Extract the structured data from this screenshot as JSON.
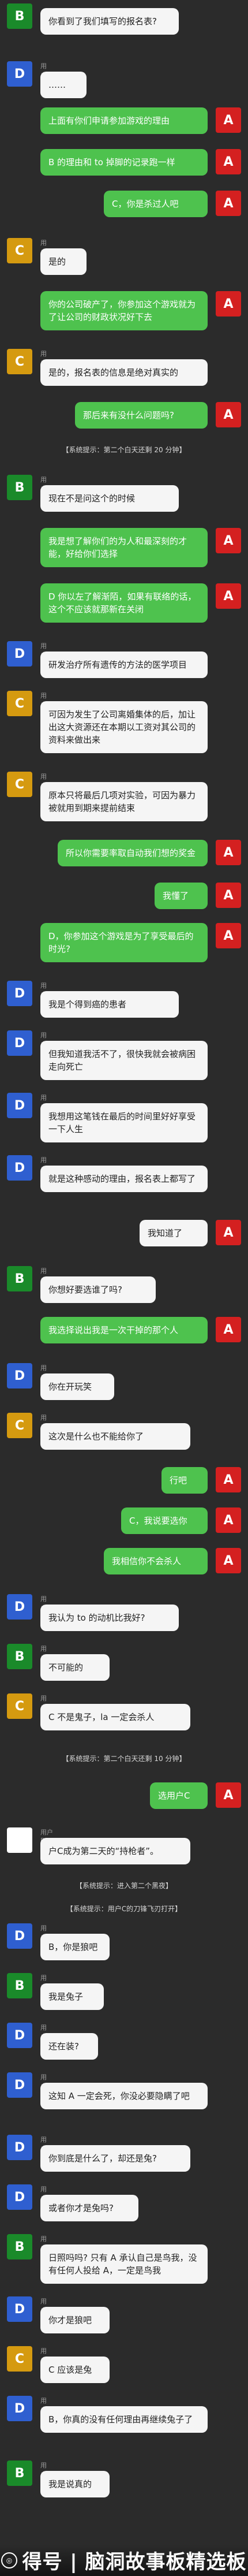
{
  "chat": {
    "messages": [
      {
        "id": 1,
        "type": "msg",
        "side": "left",
        "avatar": "B",
        "name": "",
        "text": "你看到了我们填写的报名表?",
        "bubble": "white"
      },
      {
        "id": 2,
        "type": "msg",
        "side": "left",
        "avatar": "D",
        "name": "用户D",
        "text": "……",
        "bubble": "white"
      },
      {
        "id": 3,
        "type": "msg",
        "side": "right",
        "avatar": "A",
        "text": "上面有你们申请参加游戏的理由",
        "bubble": "green"
      },
      {
        "id": 4,
        "type": "msg",
        "side": "right",
        "avatar": "A",
        "text": "B 的理由和 to 掉脚的记录跑一样",
        "bubble": "green"
      },
      {
        "id": 5,
        "type": "msg",
        "side": "right",
        "avatar": "A",
        "text": "C，你是杀过人吧",
        "bubble": "green"
      },
      {
        "id": 6,
        "type": "msg",
        "side": "left",
        "avatar": "C",
        "name": "用户C",
        "text": "是的",
        "bubble": "white"
      },
      {
        "id": 7,
        "type": "msg",
        "side": "right",
        "avatar": "A",
        "text": "你的公司破产了，你参加这个游戏就为了让公司的财政状况好下去",
        "bubble": "green"
      },
      {
        "id": 8,
        "type": "msg",
        "side": "left",
        "avatar": "C",
        "name": "用户C",
        "text": "是的，报名表的信息是绝对真实的",
        "bubble": "white"
      },
      {
        "id": 9,
        "type": "msg",
        "side": "right",
        "avatar": "A",
        "text": "那后来有没什么问题吗?",
        "bubble": "green"
      },
      {
        "id": 10,
        "type": "sys",
        "text": "【系统提示：第二个白天还剩 20 分钟】"
      },
      {
        "id": 11,
        "type": "msg",
        "side": "left",
        "avatar": "B",
        "name": "用户B",
        "text": "现在不是问这个的时候",
        "bubble": "white"
      },
      {
        "id": 12,
        "type": "msg",
        "side": "right",
        "avatar": "A",
        "text": "我是想了解你们的为人和最深刻的才能，好给你们选择",
        "bubble": "green"
      },
      {
        "id": 13,
        "type": "msg",
        "side": "right",
        "avatar": "A",
        "text": "D 你以左了解渐陌，如果有联络的话，这个不应该就那新在关闭",
        "bubble": "green"
      },
      {
        "id": 14,
        "type": "msg",
        "side": "left",
        "avatar": "D",
        "name": "用户D",
        "text": "研发治疗所有遗传的方法的医学项目",
        "bubble": "white"
      },
      {
        "id": 15,
        "type": "msg",
        "side": "left",
        "avatar": "C",
        "name": "用户C",
        "text": "可因为发生了公司离婚集体的后，加让出这大资源还在本期以工资对其公司的资料来做出来",
        "bubble": "white"
      },
      {
        "id": 16,
        "type": "msg",
        "side": "left",
        "avatar": "C",
        "name": "用户C",
        "text": "原本只将最后几项对实验，可因为暴力被就用到期来提前结束",
        "bubble": "white"
      },
      {
        "id": 17,
        "type": "msg",
        "side": "right",
        "avatar": "A",
        "text": "所以你需要率取自动我们想的奖金",
        "bubble": "green"
      },
      {
        "id": 18,
        "type": "msg",
        "side": "right",
        "avatar": "A",
        "text": "我懂了",
        "bubble": "green"
      },
      {
        "id": 19,
        "type": "msg",
        "side": "right",
        "avatar": "A",
        "text": "D，你参加这个游戏是为了享受最后的时光?",
        "bubble": "green"
      },
      {
        "id": 20,
        "type": "msg",
        "side": "left",
        "avatar": "D",
        "name": "用户D",
        "text": "我是个得到癌的患者",
        "bubble": "white"
      },
      {
        "id": 21,
        "type": "msg",
        "side": "left",
        "avatar": "D",
        "name": "用户D",
        "text": "但我知道我活不了，很快我就会被病困走向死亡",
        "bubble": "white"
      },
      {
        "id": 22,
        "type": "msg",
        "side": "left",
        "avatar": "D",
        "name": "用户D",
        "text": "我想用这笔钱在最后的时间里好好享受一下人生",
        "bubble": "white"
      },
      {
        "id": 23,
        "type": "msg",
        "side": "left",
        "avatar": "D",
        "name": "用户D",
        "text": "就是这种感动的理由，报名表上都写了",
        "bubble": "white"
      },
      {
        "id": 24,
        "type": "msg",
        "side": "right",
        "avatar": "A",
        "text": "我知道了",
        "bubble": "white"
      },
      {
        "id": 25,
        "type": "msg",
        "side": "left",
        "avatar": "B",
        "name": "用户B",
        "text": "你想好要选谁了吗?",
        "bubble": "white"
      },
      {
        "id": 26,
        "type": "msg",
        "side": "right",
        "avatar": "A",
        "text": "我选择说出我是一次干掉的那个人",
        "bubble": "green"
      },
      {
        "id": 27,
        "type": "msg",
        "side": "left",
        "avatar": "D",
        "name": "用户D",
        "text": "你在开玩笑",
        "bubble": "white"
      },
      {
        "id": 28,
        "type": "msg",
        "side": "left",
        "avatar": "C",
        "name": "用户C",
        "text": "这次是什么也不能给你了",
        "bubble": "white"
      },
      {
        "id": 29,
        "type": "msg",
        "side": "right",
        "avatar": "A",
        "text": "行吧",
        "bubble": "green"
      },
      {
        "id": 30,
        "type": "msg",
        "side": "right",
        "avatar": "A",
        "text": "C，我说要选你",
        "bubble": "green"
      },
      {
        "id": 31,
        "type": "msg",
        "side": "right",
        "avatar": "A",
        "text": "我相信你不会杀人",
        "bubble": "green"
      },
      {
        "id": 32,
        "type": "msg",
        "side": "left",
        "avatar": "D",
        "name": "用户D",
        "text": "我认为 to 的动机比我好?",
        "bubble": "white"
      },
      {
        "id": 33,
        "type": "msg",
        "side": "left",
        "avatar": "B",
        "name": "用户B",
        "text": "不可能的",
        "bubble": "white"
      },
      {
        "id": 34,
        "type": "msg",
        "side": "left",
        "avatar": "C",
        "name": "用户C",
        "text": "C 不是鬼子，la 一定会杀人",
        "bubble": "white"
      },
      {
        "id": 35,
        "type": "sys",
        "text": "【系统提示：第二个白天还剩 10 分钟】"
      },
      {
        "id": 36,
        "type": "msg",
        "side": "right",
        "avatar": "A",
        "text": "选用户C",
        "bubble": "green"
      },
      {
        "id": 37,
        "type": "msg",
        "side": "left",
        "avatar": "P",
        "name": "用户D(A)",
        "text": "户C成为第二天的“持枪者”。",
        "bubble": "white"
      },
      {
        "id": 38,
        "type": "sys",
        "text": "【系统提示：进入第二个黑夜】"
      },
      {
        "id": 39,
        "type": "sys",
        "text": "【系统提示：用户C的刀锋飞刃打开】"
      },
      {
        "id": 40,
        "type": "msg",
        "side": "left",
        "avatar": "D",
        "name": "用户D",
        "text": "B，你是狼吧",
        "bubble": "white"
      },
      {
        "id": 41,
        "type": "msg",
        "side": "left",
        "avatar": "B",
        "name": "用户B",
        "text": "我是兔子",
        "bubble": "white"
      },
      {
        "id": 42,
        "type": "msg",
        "side": "left",
        "avatar": "D",
        "name": "用户D",
        "text": "还在装?",
        "bubble": "white"
      },
      {
        "id": 43,
        "type": "msg",
        "side": "left",
        "avatar": "D",
        "name": "用户D",
        "text": "这知 A 一定会死，你没必要隐瞒了吧",
        "bubble": "white"
      },
      {
        "id": 44,
        "type": "msg",
        "side": "left",
        "avatar": "D",
        "name": "用户D",
        "text": "你到底是什么了，却还是兔?",
        "bubble": "white"
      },
      {
        "id": 45,
        "type": "msg",
        "side": "left",
        "avatar": "D",
        "name": "用户D",
        "text": "或者你才是兔吗?",
        "bubble": "white"
      },
      {
        "id": 46,
        "type": "msg",
        "side": "left",
        "avatar": "B",
        "name": "用户B",
        "text": "日照吗吗? 只有 A 承认自己是鸟我，没有任何人投给 A，一定是鸟我",
        "bubble": "white"
      },
      {
        "id": 47,
        "type": "msg",
        "side": "left",
        "avatar": "D",
        "name": "用户D",
        "text": "你才是狼吧",
        "bubble": "white"
      },
      {
        "id": 48,
        "type": "msg",
        "side": "left",
        "avatar": "C",
        "name": "用户C",
        "text": "C 应该是兔",
        "bubble": "white"
      },
      {
        "id": 49,
        "type": "msg",
        "side": "left",
        "avatar": "D",
        "name": "用户D",
        "text": "B，你真的没有任何理由再继续兔子了",
        "bubble": "white"
      },
      {
        "id": 50,
        "type": "msg",
        "side": "left",
        "avatar": "B",
        "name": "用户B",
        "text": "我是说真的",
        "bubble": "white"
      }
    ]
  },
  "watermark": {
    "text": "得号 | 脑洞故事板精选板",
    "icon": "logo-icon"
  }
}
